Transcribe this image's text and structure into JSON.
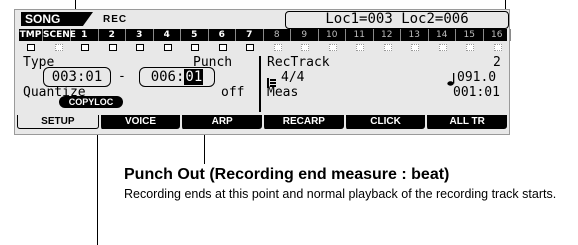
{
  "screen": {
    "mode_tab": "SONG",
    "status": "REC",
    "locators": "Loc1=003 Loc2=006",
    "track_row": {
      "labels": [
        "TMP",
        "SCENE"
      ],
      "tracks": [
        "1",
        "2",
        "3",
        "4",
        "5",
        "6",
        "7",
        "8",
        "9",
        "10",
        "11",
        "12",
        "13",
        "14",
        "15",
        "16"
      ]
    },
    "fields": {
      "type_label": "Type",
      "punch_label": "Punch",
      "punch_in": "003:01",
      "dash": "-",
      "punch_out_measure": "006:",
      "punch_out_beat": "01",
      "quantize_label": "Quantize",
      "quantize_value": "off",
      "rec_track_label": "RecTrack",
      "rec_track_value": "2",
      "time_sig_icon": "time-signature-icon",
      "time_signature": "4/4",
      "tempo_icon": "quarter-note-icon",
      "tempo": "091.0",
      "meas_label": "Meas",
      "meas_value": "001:01",
      "copyloc_button": "COPYLOC"
    },
    "tabs": [
      {
        "label": "SETUP",
        "active": true
      },
      {
        "label": "VOICE",
        "active": false
      },
      {
        "label": "ARP",
        "active": false
      },
      {
        "label": "RECARP",
        "active": false
      },
      {
        "label": "CLICK",
        "active": false
      },
      {
        "label": "ALL TR",
        "active": false
      }
    ]
  },
  "annotation": {
    "title": "Punch Out (Recording end measure : beat)",
    "description": "Recording ends at this point and normal playback of the recording track starts."
  }
}
